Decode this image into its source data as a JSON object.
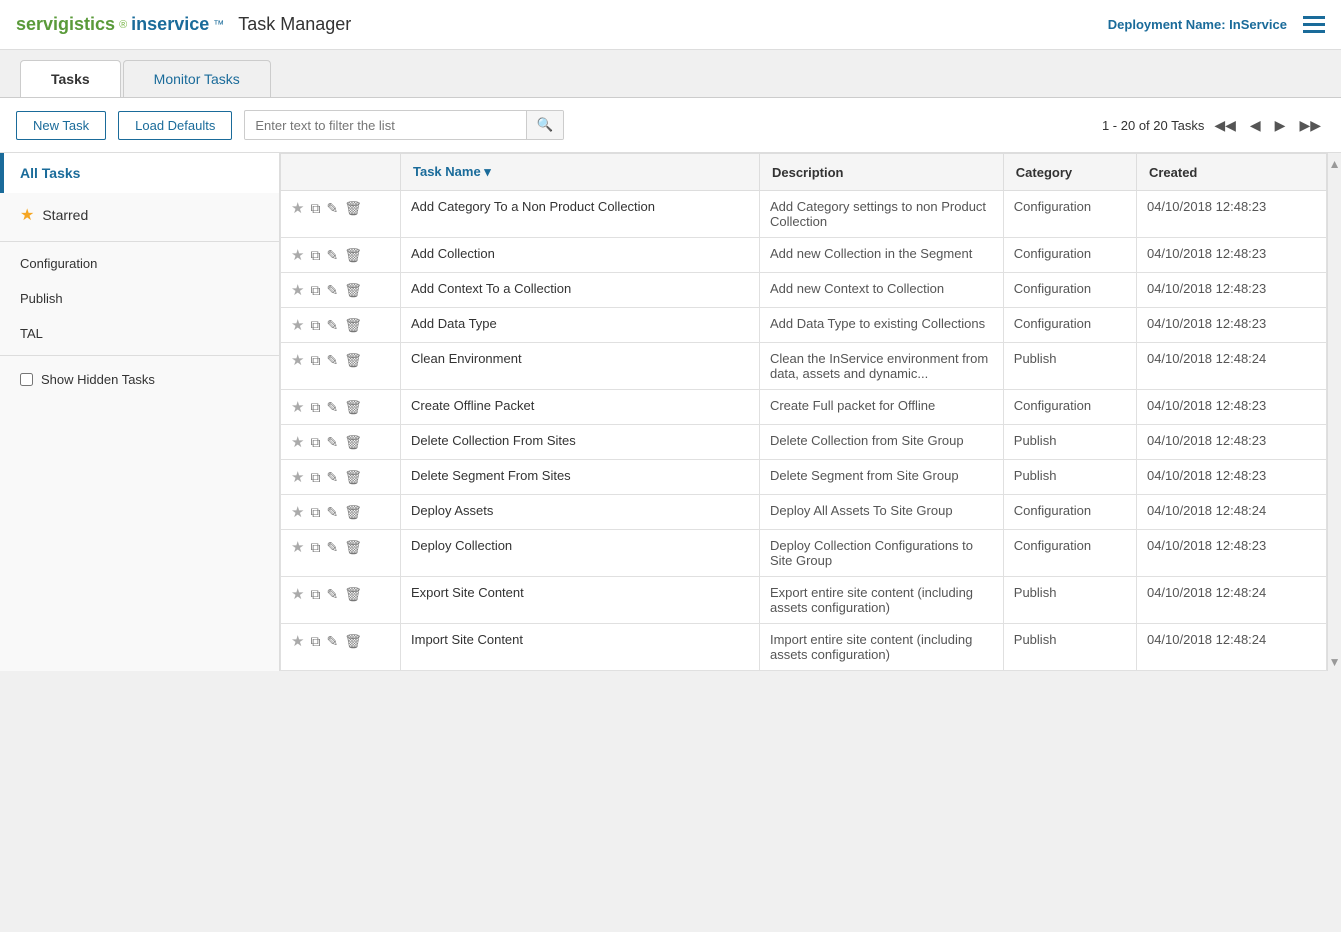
{
  "header": {
    "logo_servigistics": "servigistics",
    "logo_inservice": "inservice",
    "logo_registered": "®",
    "logo_trademark": "™",
    "logo_title": "Task Manager",
    "deployment_label": "Deployment Name:",
    "deployment_value": "InService"
  },
  "tabs": [
    {
      "id": "tasks",
      "label": "Tasks",
      "active": true
    },
    {
      "id": "monitor",
      "label": "Monitor Tasks",
      "active": false
    }
  ],
  "toolbar": {
    "new_task_label": "New Task",
    "load_defaults_label": "Load Defaults",
    "filter_placeholder": "Enter text to filter the list",
    "pagination_info": "1 - 20 of 20 Tasks"
  },
  "sidebar": {
    "all_tasks_label": "All Tasks",
    "starred_label": "Starred",
    "categories": [
      {
        "id": "configuration",
        "label": "Configuration"
      },
      {
        "id": "publish",
        "label": "Publish"
      },
      {
        "id": "tal",
        "label": "TAL"
      }
    ],
    "show_hidden_label": "Show Hidden Tasks"
  },
  "table": {
    "columns": [
      {
        "id": "actions",
        "label": ""
      },
      {
        "id": "name",
        "label": "Task Name",
        "sortable": true
      },
      {
        "id": "description",
        "label": "Description"
      },
      {
        "id": "category",
        "label": "Category"
      },
      {
        "id": "created",
        "label": "Created"
      }
    ],
    "rows": [
      {
        "name": "Add Category To a Non Product Collection",
        "description": "Add Category settings to non Product Collection",
        "category": "Configuration",
        "created": "04/10/2018 12:48:23"
      },
      {
        "name": "Add Collection",
        "description": "Add new Collection in the Segment",
        "category": "Configuration",
        "created": "04/10/2018 12:48:23"
      },
      {
        "name": "Add Context To a Collection",
        "description": "Add new Context to Collection",
        "category": "Configuration",
        "created": "04/10/2018 12:48:23"
      },
      {
        "name": "Add Data Type",
        "description": "Add Data Type to existing Collections",
        "category": "Configuration",
        "created": "04/10/2018 12:48:23"
      },
      {
        "name": "Clean Environment",
        "description": "Clean the InService environment from data, assets and dynamic...",
        "category": "Publish",
        "created": "04/10/2018 12:48:24"
      },
      {
        "name": "Create Offline Packet",
        "description": "Create Full packet for Offline",
        "category": "Configuration",
        "created": "04/10/2018 12:48:23"
      },
      {
        "name": "Delete Collection From Sites",
        "description": "Delete Collection from Site Group",
        "category": "Publish",
        "created": "04/10/2018 12:48:23"
      },
      {
        "name": "Delete Segment From Sites",
        "description": "Delete Segment from Site Group",
        "category": "Publish",
        "created": "04/10/2018 12:48:23"
      },
      {
        "name": "Deploy Assets",
        "description": "Deploy All Assets To Site Group",
        "category": "Configuration",
        "created": "04/10/2018 12:48:24"
      },
      {
        "name": "Deploy Collection",
        "description": "Deploy Collection Configurations to Site Group",
        "category": "Configuration",
        "created": "04/10/2018 12:48:23"
      },
      {
        "name": "Export Site Content",
        "description": "Export entire site content (including assets configuration)",
        "category": "Publish",
        "created": "04/10/2018 12:48:24"
      },
      {
        "name": "Import Site Content",
        "description": "Import entire site content (including assets configuration)",
        "category": "Publish",
        "created": "04/10/2018 12:48:24"
      }
    ]
  }
}
